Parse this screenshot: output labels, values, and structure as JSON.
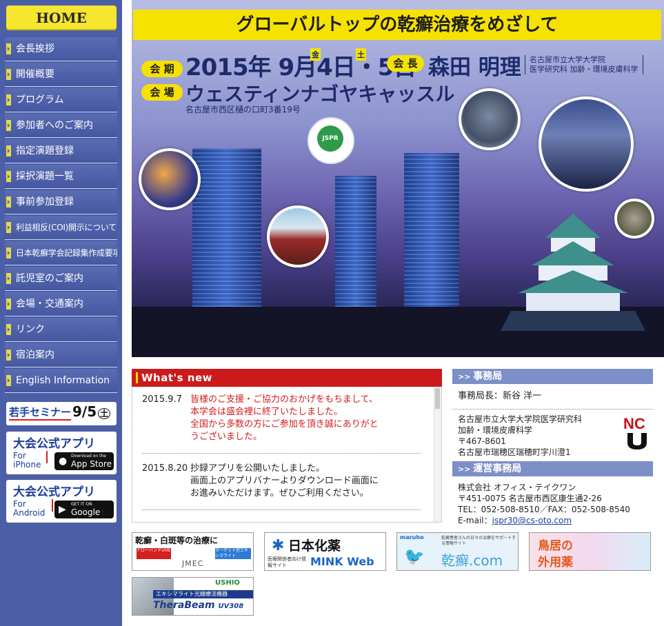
{
  "sidebar": {
    "home": "HOME",
    "items": [
      {
        "label": "会長挨拶"
      },
      {
        "label": "開催概要"
      },
      {
        "label": "プログラム"
      },
      {
        "label": "参加者へのご案内"
      },
      {
        "label": "指定演題登録"
      },
      {
        "label": "採択演題一覧"
      },
      {
        "label": "事前参加登録"
      },
      {
        "label": "利益相反(COI)開示について"
      },
      {
        "label": "日本乾癬学会記録集作成要項"
      },
      {
        "label": "託児室のご案内"
      },
      {
        "label": "会場・交通案内"
      },
      {
        "label": "リンク"
      },
      {
        "label": "宿泊案内"
      },
      {
        "label": "English Information"
      }
    ],
    "seminar": {
      "title": "若手セミナー",
      "date": "9/5",
      "day": "土"
    },
    "app_iphone": {
      "title": "大会公式アプリ",
      "for": "For",
      "platform": "iPhone",
      "store_small": "Download on the",
      "store_big": "App Store"
    },
    "app_android": {
      "title": "大会公式アプリ",
      "for": "For",
      "platform": "Android",
      "store_small": "GET IT ON",
      "store_big": "Google play"
    }
  },
  "hero": {
    "title": "グローバルトップの乾癬治療をめざして",
    "period_tag": "会 期",
    "date": "2015年 9月4日・5日",
    "day1": "金",
    "day2": "土",
    "chair_tag": "会 長",
    "chair": "森田 明理",
    "aff1": "名古屋市立大学大学院",
    "aff2": "医学研究科 加齢・環境皮膚科学",
    "venue_tag": "会 場",
    "venue": "ウェスティンナゴヤキャッスル",
    "address": "名古屋市西区樋の口町3番19号",
    "logo": "JSPR"
  },
  "news": {
    "heading": "What's new",
    "items": [
      {
        "date": "2015.9.7",
        "lines": [
          "皆様のご支援・ご協力のおかげをもちまして、",
          "本学会は盛会裡に終了いたしました。",
          "全国から多数の方にご参加を頂き誠にありがと",
          "うございました。"
        ]
      },
      {
        "date": "2015.8.20",
        "lines": [
          "抄録アプリを公開いたしました。",
          "画面上のアプリバナーよりダウンロード画面に",
          "お進みいただけます。ぜひご利用ください。"
        ]
      }
    ]
  },
  "secretariat": {
    "heading": "事務局",
    "director": "事務局長：新谷 洋一",
    "lines": [
      "名古屋市立大学大学院医学研究科",
      "加齢・環境皮膚科学",
      "〒467-8601",
      "名古屋市瑞穂区瑞穂町字川澄1"
    ]
  },
  "operations": {
    "heading": "運営事務局",
    "lines": [
      "株式会社 オフィス・テイクワン",
      "〒451-0075 名古屋市西区康生通2-26",
      "TEL：052-508-8510／FAX：052-508-8540"
    ],
    "email_label": "E-mail：",
    "email": "jspr30@cs-oto.com"
  },
  "ads": {
    "ad1": {
      "title": "乾癬・白斑等の治療に",
      "sub1": "ナローバンドUVB",
      "sub2": "ターゲット型エキシマライト",
      "brand": "JMEC"
    },
    "ad2": {
      "title": "日本化薬",
      "sub": "医療関係者向け情報サイト",
      "brand": "MINK Web"
    },
    "ad3": {
      "brand": "maruho",
      "sub": "乾癬患者さんの日々の治療をサポートする情報サイト",
      "site": "乾癬.com"
    },
    "ad4": {
      "title1": "鳥居の",
      "title2": "外用薬"
    },
    "ad5": {
      "brand": "USHIO",
      "sub": "エキシマライト光線療法機器",
      "product": "TheraBeam",
      "model": "UV308"
    }
  },
  "colors": {
    "sidebar": "#4b5ea6",
    "accent_yellow": "#f6e200",
    "news_red": "#cc1a1a",
    "info_head": "#7d8fc7"
  }
}
